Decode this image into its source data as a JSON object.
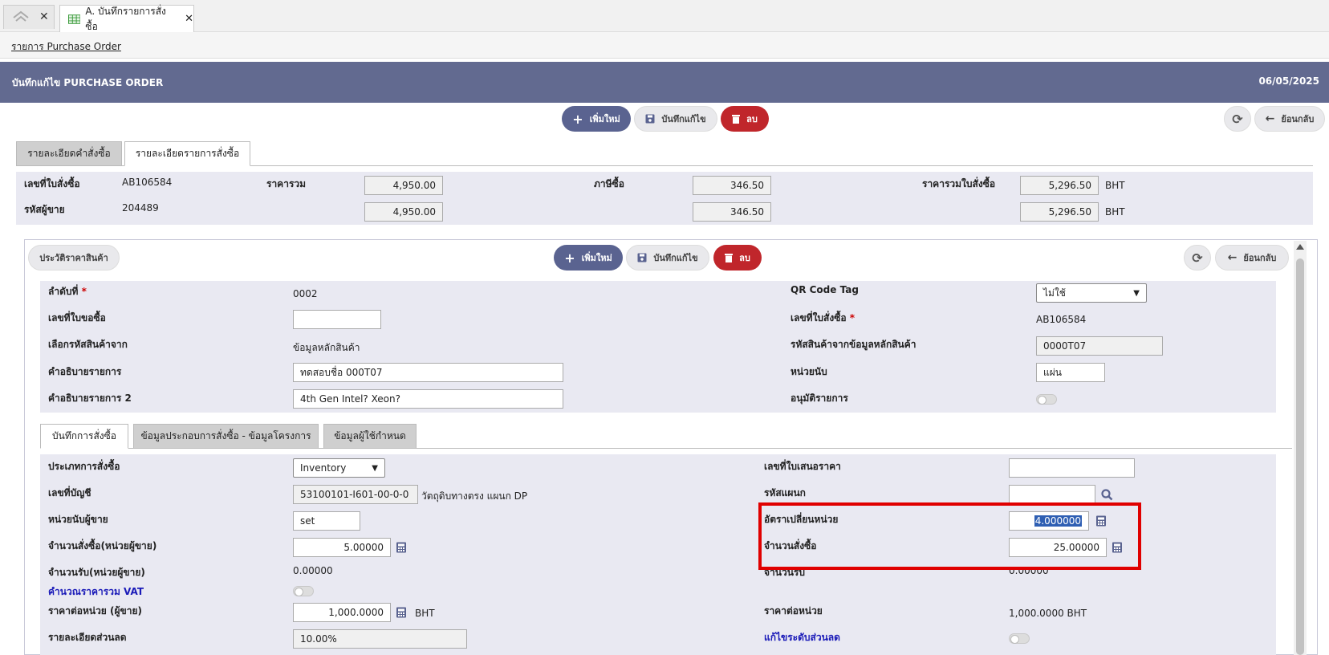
{
  "tabs": {
    "doc_title": "A. บันทึกรายการสั่งซื้อ"
  },
  "breadcrumb": "รายการ Purchase Order",
  "header": {
    "title": "บันทึกแก้ไข PURCHASE ORDER",
    "date": "06/05/2025"
  },
  "toolbar": {
    "add": "เพิ่มใหม่",
    "save": "บันทึกแก้ไข",
    "delete": "ลบ",
    "back": "ย้อนกลับ"
  },
  "main_tabs": [
    "รายละเอียดคำสั่งซื้อ",
    "รายละเอียดรายการสั่งซื้อ"
  ],
  "summary": {
    "po_no_label": "เลขที่ใบสั่งซื้อ",
    "po_no": "AB106584",
    "vendor_label": "รหัสผู้ขาย",
    "vendor": "204489",
    "total_label": "ราคารวม",
    "total1": "4,950.00",
    "total2": "4,950.00",
    "tax_label": "ภาษีซื้อ",
    "tax1": "346.50",
    "tax2": "346.50",
    "grand_label": "ราคารวมใบสั่งซื้อ",
    "grand1": "5,296.50",
    "grand2": "5,296.50",
    "currency": "BHT"
  },
  "sub_toolbar": {
    "history": "ประวัติราคาสินค้า",
    "add": "เพิ่มใหม่",
    "save": "บันทึกแก้ไข",
    "delete": "ลบ",
    "back": "ย้อนกลับ"
  },
  "item": {
    "seq_label": "ลำดับที่",
    "seq": "0002",
    "pr_no_label": "เลขที่ใบขอซื้อ",
    "pr_no": "",
    "select_from_label": "เลือกรหัสสินค้าจาก",
    "select_from": "ข้อมูลหลักสินค้า",
    "desc_label": "คำอธิบายรายการ",
    "desc": "ทดสอบชื่อ 000T07",
    "desc2_label": "คำอธิบายรายการ 2",
    "desc2": "4th Gen Intel? Xeon?",
    "qr_label": "QR Code Tag",
    "qr": "ไม่ใช้",
    "po_no_label": "เลขที่ใบสั่งซื้อ",
    "po_no": "AB106584",
    "product_code_label": "รหัสสินค้าจากข้อมูลหลักสินค้า",
    "product_code": "0000T07",
    "unit_label": "หน่วยนับ",
    "unit": "แผ่น",
    "approve_label": "อนุมัติรายการ"
  },
  "sub_tabs": [
    "บันทึกการสั่งซื้อ",
    "ข้อมูลประกอบการสั่งซื้อ - ข้อมูลโครงการ",
    "ข้อมูลผู้ใช้กำหนด"
  ],
  "order": {
    "type_label": "ประเภทการสั่งซื้อ",
    "type": "Inventory",
    "account_label": "เลขที่บัญชี",
    "account": "53100101-I601-00-0-0",
    "account_desc": "วัตถุดิบทางตรง แผนก DP",
    "vendor_unit_label": "หน่วยนับผู้ขาย",
    "vendor_unit": "set",
    "qty_vendor_label": "จำนวนสั่งซื้อ(หน่วยผู้ขาย)",
    "qty_vendor": "5.00000",
    "recv_vendor_label": "จำนวนรับ(หน่วยผู้ขาย)",
    "recv_vendor": "0.00000",
    "vat_label": "คำนวณราคารวม VAT",
    "price_vendor_label": "ราคาต่อหน่วย (ผู้ขาย)",
    "price_vendor": "1,000.0000",
    "currency": "BHT",
    "discount_label": "รายละเอียดส่วนลด",
    "discount": "10.00%",
    "quote_label": "เลขที่ใบเสนอราคา",
    "quote": "",
    "dept_label": "รหัสแผนก",
    "dept": "",
    "rate_label": "อัตราเปลี่ยนหน่วย",
    "rate": "4.000000",
    "qty_label": "จำนวนสั่งซื้อ",
    "qty": "25.00000",
    "recv_label": "จำนวนรับ",
    "recv": "0.00000",
    "price_label": "ราคาต่อหน่วย",
    "price": "1,000.0000",
    "disc_level_label": "แก้ไขระดับส่วนลด"
  }
}
